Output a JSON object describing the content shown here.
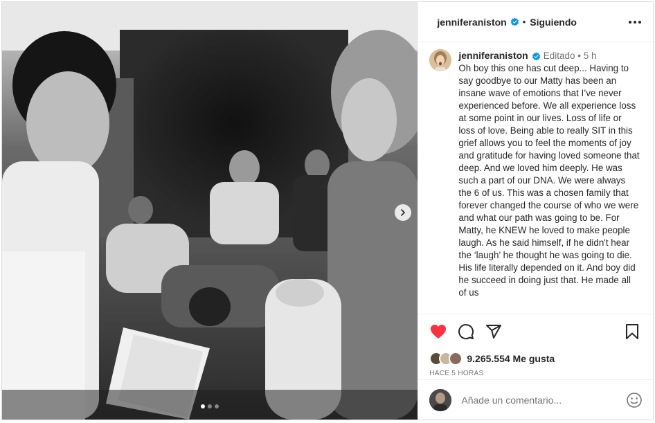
{
  "post": {
    "username": "jenniferaniston",
    "follow_status": "Siguiendo",
    "separator": "•",
    "edited_label": "Editado",
    "time_short": "5 h",
    "caption": "Oh boy this one has cut deep... Having to say goodbye to our Matty has been an insane wave of emotions that I’ve never experienced before. We all experience loss at some point in our lives. Loss of life or loss of love. Being able to really SIT in this grief allows you to feel the moments of joy and gratitude for having loved someone that deep. And we loved him deeply. He was such a part of our DNA. We were always the 6 of us. This was a chosen family that forever changed the course of who we were and what our path was going to be. For Matty, he KNEW he loved to make people laugh. As he said himself, if he didn't hear the ‘laugh’ he thought he was going to die. His life literally depended on it. And boy did he succeed in doing just that. He made all of us",
    "likes": "9.265.554 Me gusta",
    "posted_ago": "HACE 5 HORAS",
    "carousel": {
      "count": 3,
      "active_index": 0
    }
  },
  "comment": {
    "placeholder": "Añade un comentario..."
  },
  "icons": {
    "verified": "verified-badge-icon",
    "more": "more-options-icon",
    "next": "chevron-right-icon",
    "like": "heart-filled-icon",
    "comment": "comment-bubble-icon",
    "share": "paper-plane-icon",
    "save": "bookmark-icon",
    "emoji": "emoji-smile-icon"
  },
  "colors": {
    "verified_blue": "#0095f6",
    "like_red": "#ff3040",
    "text": "#262626",
    "muted": "#737373",
    "border": "#dbdbdb"
  }
}
